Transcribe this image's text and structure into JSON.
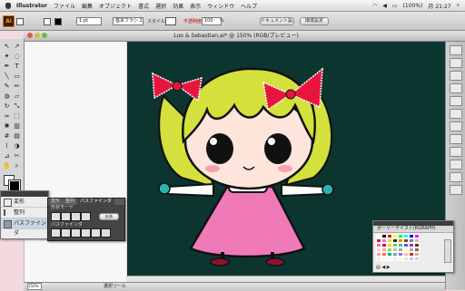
{
  "menubar": {
    "app": "Illustrator",
    "items": [
      "ファイル",
      "編集",
      "オブジェクト",
      "書式",
      "選択",
      "効果",
      "表示",
      "ウィンドウ",
      "ヘルプ"
    ],
    "battery": "(100%)",
    "clock": "月 21:27"
  },
  "control": {
    "logo": "Ai",
    "stroke_weight": "1 pt",
    "brush": "基本ブラシ 2",
    "style_label": "スタイル",
    "opacity_label": "不透明度",
    "opacity_value": "100",
    "opacity_unit": "%",
    "doc_setup": "ドキュメント設定",
    "prefs": "環境設定"
  },
  "document": {
    "title": "Luo & Sebastian.ai* @ 150% (RGB/プレビュー)"
  },
  "panels": {
    "transform_label": "変形",
    "align_label": "整列",
    "pathfinder_label": "パスファインダ",
    "tabs": [
      "変形",
      "整列",
      "パスファインダ"
    ],
    "shape_mode_label": "形状モード",
    "expand_label": "拡張",
    "pathfinder_section": "パスファインダ",
    "swatch_title": "ポーリーテイスト(RGRAPH)"
  },
  "status": {
    "zoom": "150%",
    "tool_name": "選択ツール"
  },
  "colors": {
    "canvas_bg": "#0c3530",
    "hair": "#d4e03c",
    "bow": "#e8163f",
    "dress": "#f07ab8",
    "desktop": "#f4d9de"
  },
  "swatches": [
    "#ffffff",
    "#000000",
    "#ff0000",
    "#ffff00",
    "#00ff00",
    "#00ffff",
    "#0000ff",
    "#ff00ff",
    "#e8163f",
    "#f07ab8",
    "#d4e03c",
    "#0c3530",
    "#ff8c00",
    "#8b4513",
    "#808080",
    "#c0c0c0",
    "#ff66cc",
    "#cc0066",
    "#ffcc00",
    "#99cc00",
    "#33cc99",
    "#3366ff",
    "#9933cc",
    "#663300",
    "#ffd1dc",
    "#ffb347",
    "#77dd77",
    "#aec6cf",
    "#b39eb5",
    "#fdfd96",
    "#cb99c9",
    "#836953",
    "#f49ac2",
    "#ff6961",
    "#03c03c",
    "#779ecb",
    "#966fd6",
    "#ffb7b2",
    "#c23b22",
    "#dea5a4",
    "#ffe4e1",
    "#fafad2",
    "#e0ffff",
    "#e6e6fa",
    "#f5f5dc",
    "#ffdab9",
    "#d8bfd8",
    "#b0e0e6"
  ]
}
